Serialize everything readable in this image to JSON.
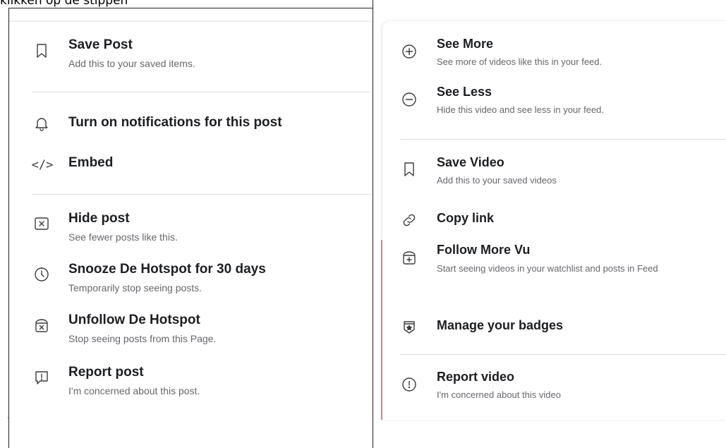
{
  "caption": "klikken op de stippen",
  "left_menu": {
    "items": [
      {
        "icon": "bookmark-icon",
        "title": "Save Post",
        "subtitle": "Add this to your saved items."
      },
      {
        "icon": "bell-icon",
        "title": "Turn on notifications for this post",
        "subtitle": ""
      },
      {
        "icon": "code-icon",
        "title": "Embed",
        "subtitle": ""
      },
      {
        "icon": "hide-x-icon",
        "title": "Hide post",
        "subtitle": "See fewer posts like this."
      },
      {
        "icon": "clock-icon",
        "title": "Snooze De Hotspot for 30 days",
        "subtitle": "Temporarily stop seeing posts."
      },
      {
        "icon": "unfollow-icon",
        "title": "Unfollow De Hotspot",
        "subtitle": "Stop seeing posts from this Page."
      },
      {
        "icon": "report-flag-icon",
        "title": "Report post",
        "subtitle": "I'm concerned about this post."
      }
    ],
    "code_glyph": "</>"
  },
  "right_menu": {
    "items": [
      {
        "icon": "plus-circle-icon",
        "title": "See More",
        "subtitle": "See more of videos like this in your feed."
      },
      {
        "icon": "minus-circle-icon",
        "title": "See Less",
        "subtitle": "Hide this video and see less in your feed."
      },
      {
        "icon": "bookmark-icon",
        "title": "Save Video",
        "subtitle": "Add this to your saved videos"
      },
      {
        "icon": "link-icon",
        "title": "Copy link",
        "subtitle": ""
      },
      {
        "icon": "follow-plus-icon",
        "title": "Follow More Vu",
        "subtitle": "Start seeing videos in your watchlist and posts in Feed"
      },
      {
        "icon": "badge-icon",
        "title": "Manage your badges",
        "subtitle": ""
      },
      {
        "icon": "alert-circle-icon",
        "title": "Report video",
        "subtitle": "I'm concerned about this video"
      }
    ]
  }
}
